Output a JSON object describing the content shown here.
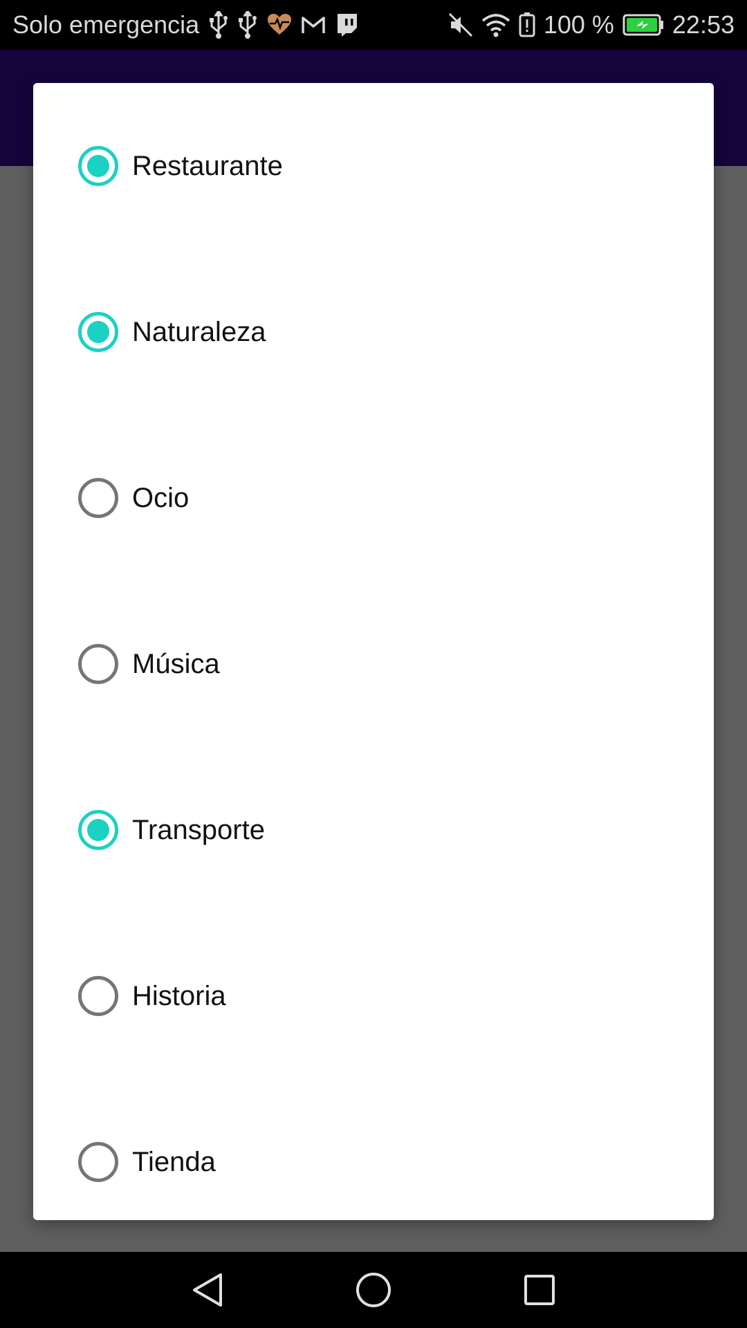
{
  "theme": {
    "accent": "#1bd1c2",
    "app_bar_color": "#15053c"
  },
  "status_bar": {
    "carrier_text": "Solo emergencia",
    "left_icons": [
      "usb-icon",
      "usb-icon",
      "health-icon",
      "gmail-icon",
      "twitch-icon"
    ],
    "right_icons": [
      "mute-icon",
      "wifi-icon",
      "battery-alert-icon"
    ],
    "battery_percent": "100 %",
    "time": "22:53"
  },
  "dialog": {
    "options": [
      {
        "label": "Restaurante",
        "checked": true
      },
      {
        "label": "Naturaleza",
        "checked": true
      },
      {
        "label": "Ocio",
        "checked": false
      },
      {
        "label": "Música",
        "checked": false
      },
      {
        "label": "Transporte",
        "checked": true
      },
      {
        "label": "Historia",
        "checked": false
      },
      {
        "label": "Tienda",
        "checked": false
      }
    ]
  },
  "nav_bar": {
    "buttons": [
      "back-icon",
      "home-icon",
      "recents-icon"
    ]
  }
}
